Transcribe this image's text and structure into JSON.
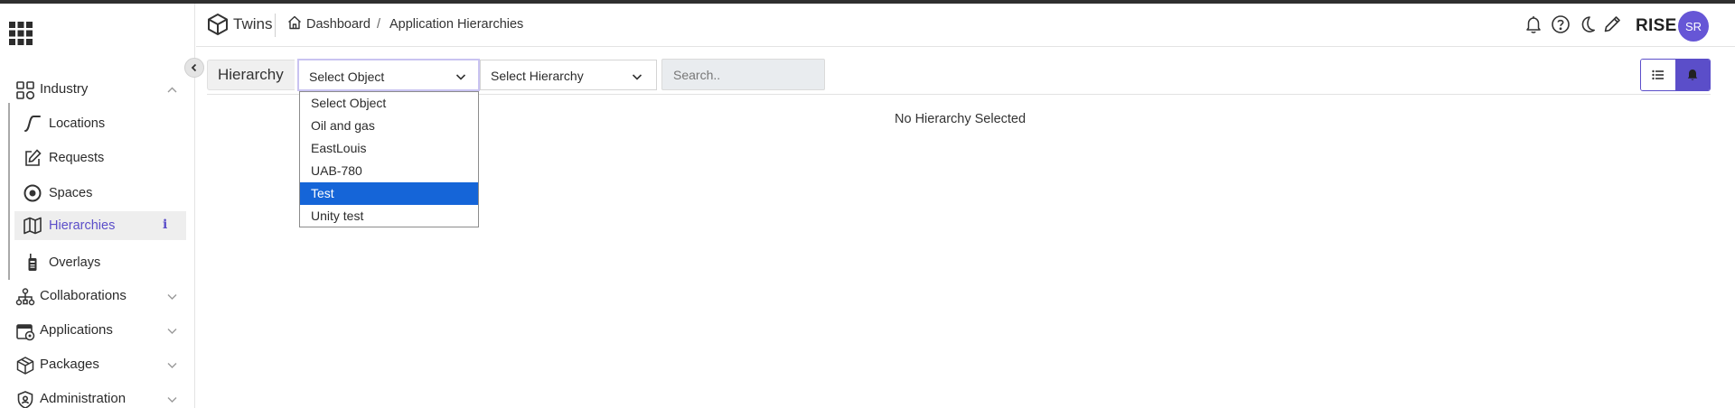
{
  "brand": {
    "name": "Twins"
  },
  "breadcrumb": {
    "home": "Dashboard",
    "separator": "/",
    "current": "Application Hierarchies"
  },
  "header": {
    "org": "RISE",
    "avatar_initials": "SR"
  },
  "sidebar": {
    "groups": [
      {
        "label": "Industry",
        "icon": "grid-icon",
        "expanded": true
      },
      {
        "label": "Collaborations",
        "icon": "network-icon",
        "expanded": false
      },
      {
        "label": "Applications",
        "icon": "applications-icon",
        "expanded": false
      },
      {
        "label": "Packages",
        "icon": "package-icon",
        "expanded": false
      },
      {
        "label": "Administration",
        "icon": "shield-icon",
        "expanded": false
      }
    ],
    "industry_items": [
      {
        "label": "Locations",
        "icon": "curve-icon"
      },
      {
        "label": "Requests",
        "icon": "edit-icon"
      },
      {
        "label": "Spaces",
        "icon": "target-icon"
      },
      {
        "label": "Hierarchies",
        "icon": "map-icon",
        "active": true,
        "badge": "i"
      },
      {
        "label": "Overlays",
        "icon": "walkie-talkie-icon"
      }
    ]
  },
  "toolbar": {
    "label": "Hierarchy",
    "object_select": {
      "value": "Select Object"
    },
    "hierarchy_select": {
      "value": "Select Hierarchy"
    },
    "search": {
      "placeholder": "Search.."
    }
  },
  "dropdown": {
    "options": [
      "Select Object",
      "Oil and gas",
      "EastLouis",
      "UAB-780",
      "Test",
      "Unity test"
    ],
    "highlighted_index": 4
  },
  "main": {
    "empty_message": "No Hierarchy Selected"
  },
  "colors": {
    "accent": "#5b4ec9",
    "highlight": "#1565d8",
    "avatar": "#6656d6"
  }
}
